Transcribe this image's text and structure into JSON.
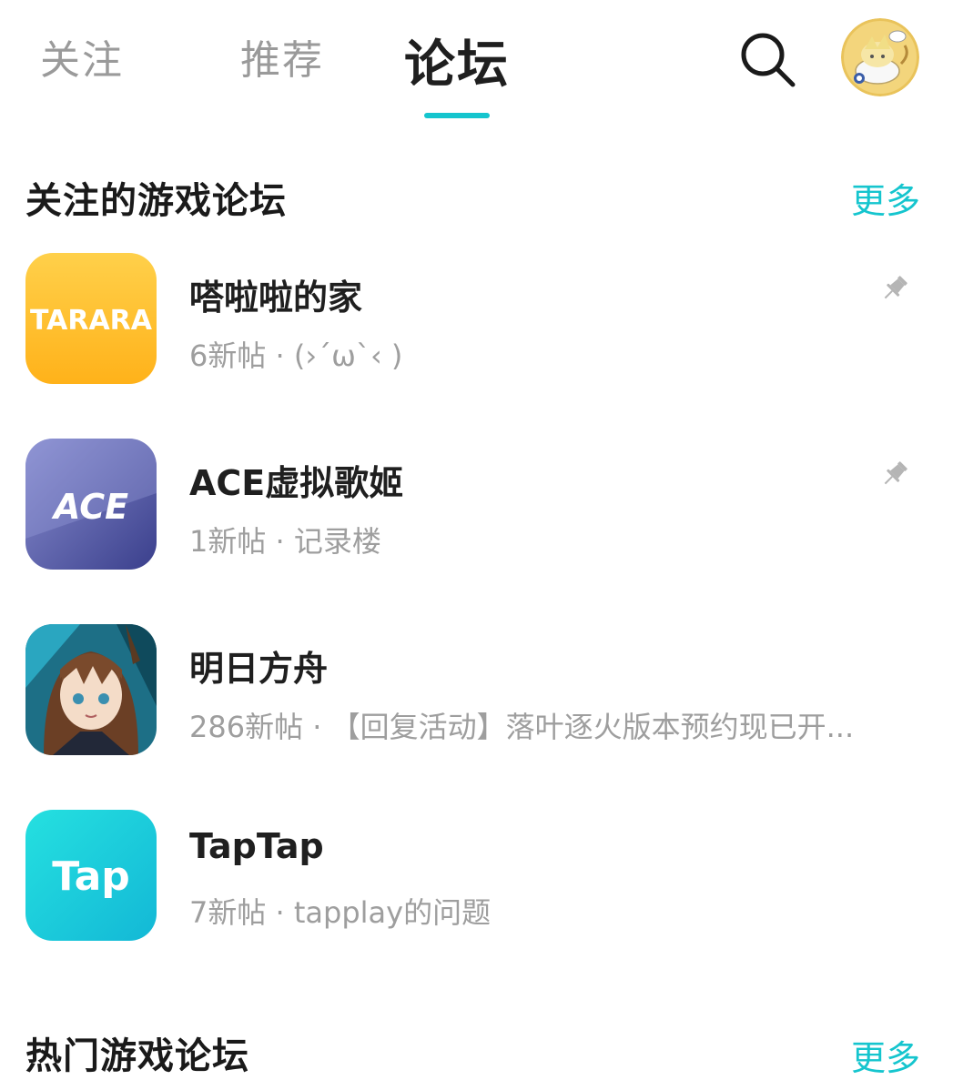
{
  "tabs": [
    {
      "label": "关注"
    },
    {
      "label": "推荐"
    },
    {
      "label": "论坛"
    }
  ],
  "active_tab": "论坛",
  "icons": {
    "search": "search-icon",
    "avatar": "avatar",
    "pin": "pin-icon"
  },
  "colors": {
    "accent": "#15c5ce",
    "title": "#1f1f1f",
    "muted": "#9e9e9e"
  },
  "followed_section": {
    "title": "关注的游戏论坛",
    "more": "更多",
    "forums": [
      {
        "name": "嗒啦啦的家",
        "subtitle": "6新帖 · (›´ω`‹ )",
        "pinned": true,
        "icon_text": "TARARA"
      },
      {
        "name": "ACE虚拟歌姬",
        "subtitle": "1新帖 · 记录楼",
        "pinned": true,
        "icon_text": "ACE"
      },
      {
        "name": "明日方舟",
        "subtitle": "286新帖 · 【回复活动】落叶逐火版本预约现已开...",
        "pinned": false,
        "icon_text": ""
      },
      {
        "name": "TapTap",
        "subtitle": "7新帖 · tapplay的问题",
        "pinned": false,
        "icon_text": "Tap"
      }
    ]
  },
  "hot_section": {
    "title": "热门游戏论坛",
    "more": "更多"
  }
}
